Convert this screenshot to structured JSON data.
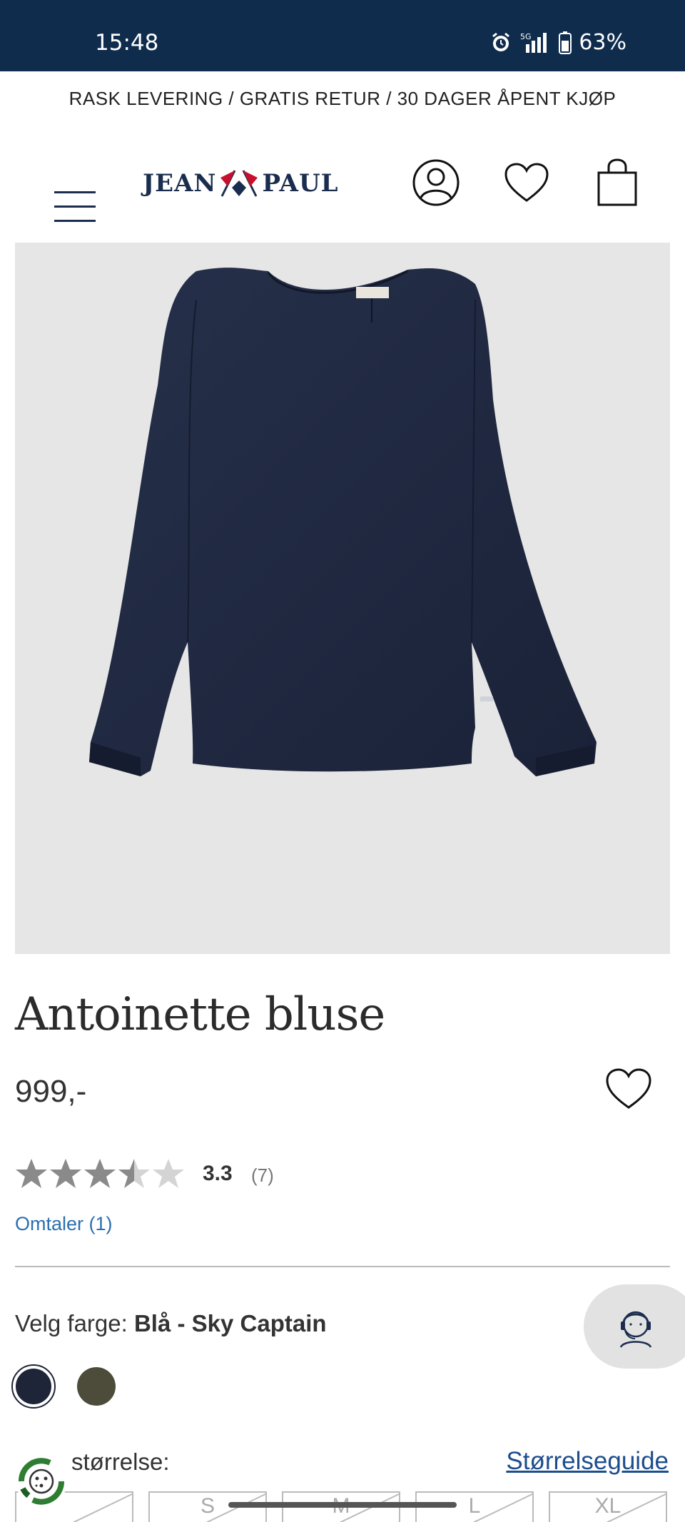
{
  "status_bar": {
    "time": "15:48",
    "network": "5G",
    "battery": "63%"
  },
  "promo": {
    "text": "RASK LEVERING / GRATIS RETUR / 30 DAGER ÅPENT KJØP"
  },
  "header": {
    "logo_left": "JEAN",
    "logo_right": "PAUL"
  },
  "product": {
    "title": "Antoinette bluse",
    "price": "999,-",
    "rating": {
      "value": "3.3",
      "count": "(7)",
      "stars_filled": 3.3,
      "stars_total": 5
    },
    "reviews_link": "Omtaler (1)",
    "color": {
      "label": "Velg farge: ",
      "selected": "Blå - Sky Captain",
      "swatches": [
        "#1f2538",
        "#4d4c3a"
      ]
    },
    "size": {
      "label": "størrelse:",
      "guide_link": "Størrelseguide",
      "options": [
        "S",
        "M",
        "L",
        "XL"
      ]
    }
  },
  "colors": {
    "status_bar": "#0f2c4d",
    "brand_navy": "#1b2d4f",
    "link_blue": "#2c6fb0",
    "image_bg": "#e6e6e6"
  }
}
